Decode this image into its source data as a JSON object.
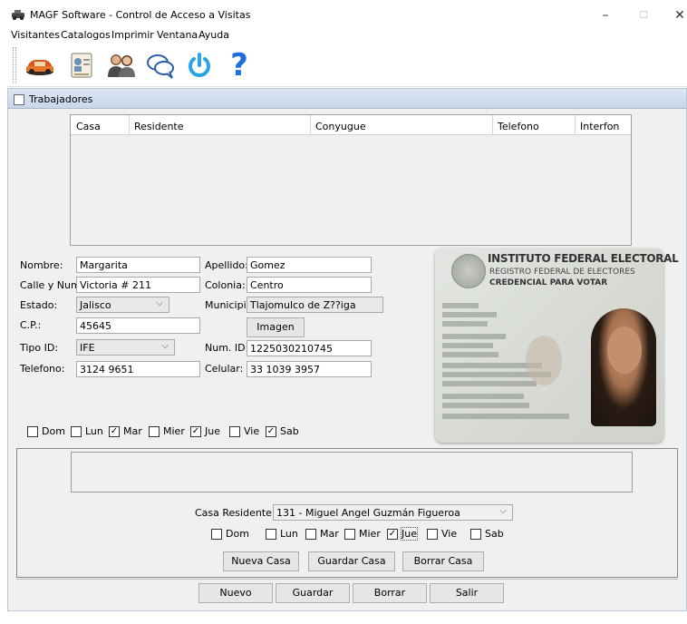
{
  "window": {
    "title": "MAGF Software - Control de Acceso a Visitas",
    "minimize": "–",
    "maximize": "☐",
    "close": "✕"
  },
  "menu": [
    "Visitantes",
    "Catalogos",
    "Imprimir",
    "Ventana",
    "Ayuda"
  ],
  "toolbar": [
    {
      "icon": "car-icon"
    },
    {
      "icon": "id-card-icon"
    },
    {
      "icon": "people-icon"
    },
    {
      "icon": "chat-icon"
    },
    {
      "icon": "power-icon"
    },
    {
      "icon": "help-icon",
      "glyph": "?"
    }
  ],
  "frame": {
    "title": "Trabajadores"
  },
  "table": {
    "columns": [
      "Casa",
      "Residente",
      "Conyugue",
      "Telefono",
      "Interfon"
    ]
  },
  "form": {
    "nombre_label": "Nombre:",
    "nombre": "Margarita",
    "apellido_label": "Apellido:",
    "apellido": "Gomez",
    "calle_label": "Calle y Num.:",
    "calle": "Victoria # 211",
    "colonia_label": "Colonia:",
    "colonia": "Centro",
    "estado_label": "Estado:",
    "estado": "Jalisco",
    "municipio_label": "Municipio:",
    "municipio": "Tlajomulco de Z??iga",
    "cp_label": "C.P.:",
    "cp": "45645",
    "imagen_button": "Imagen",
    "tipo_id_label": "Tipo ID:",
    "tipo_id": "IFE",
    "num_id_label": "Num. ID:",
    "num_id": "1225030210745",
    "telefono_label": "Telefono:",
    "telefono": "3124 9651",
    "celular_label": "Celular:",
    "celular": "33 1039 3957"
  },
  "days_worker": [
    {
      "label": "Dom",
      "checked": false
    },
    {
      "label": "Lun",
      "checked": false
    },
    {
      "label": "Mar",
      "checked": true
    },
    {
      "label": "Mier",
      "checked": false
    },
    {
      "label": "Jue",
      "checked": true
    },
    {
      "label": "Vie",
      "checked": false
    },
    {
      "label": "Sab",
      "checked": true
    }
  ],
  "credential": {
    "line1": "INSTITUTO FEDERAL ELECTORAL",
    "line2": "REGISTRO FEDERAL DE ELECTORES",
    "line3": "CREDENCIAL PARA VOTAR"
  },
  "casa": {
    "label": "Casa Residente:",
    "value": "131 - Miguel Angel Guzmán Figueroa"
  },
  "days_house": [
    {
      "label": "Dom",
      "checked": false
    },
    {
      "label": "Lun",
      "checked": false
    },
    {
      "label": "Mar",
      "checked": false
    },
    {
      "label": "Mier",
      "checked": false
    },
    {
      "label": "Jue",
      "checked": true
    },
    {
      "label": "Vie",
      "checked": false
    },
    {
      "label": "Sab",
      "checked": false
    }
  ],
  "house_buttons": [
    "Nueva Casa",
    "Guardar Casa",
    "Borrar Casa"
  ],
  "footer_buttons": [
    "Nuevo",
    "Guardar",
    "Borrar",
    "Salir"
  ],
  "colors": {
    "frame_title": "#c9d7ea",
    "help_blue": "#1e6fd9",
    "power_blue": "#2aa3e8"
  }
}
